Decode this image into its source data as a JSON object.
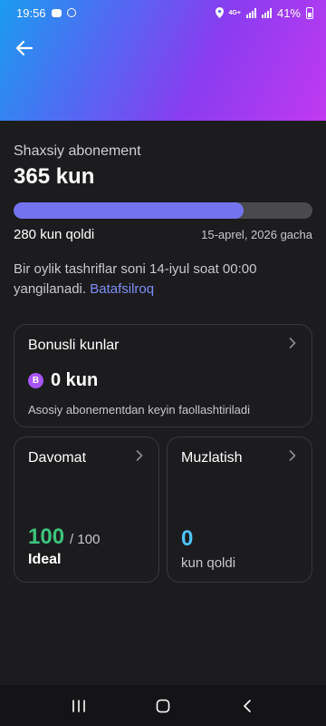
{
  "status_bar": {
    "time": "19:56",
    "network": "4G+",
    "battery": "41%"
  },
  "subscription": {
    "title": "Shaxsiy abonement",
    "total": "365 kun",
    "progress_fraction": 0.77,
    "remaining": "280 kun qoldi",
    "until": "15-aprel, 2026 gacha",
    "info_text": "Bir oylik tashriflar soni 14-iyul soat 00:00 yangilanadi.",
    "info_link": "Batafsilroq"
  },
  "bonus": {
    "title": "Bonusli kunlar",
    "badge": "B",
    "value": "0 kun",
    "description": "Asosiy abonementdan keyin faollashtiriladi"
  },
  "attendance": {
    "title": "Davomat",
    "value": "100",
    "max": "/ 100",
    "label": "Ideal"
  },
  "freeze": {
    "title": "Muzlatish",
    "value": "0",
    "label": "kun qoldi"
  },
  "colors": {
    "progress_fill": "#7474ef",
    "attendance_value": "#3cc47c",
    "freeze_value": "#4fc3f7",
    "badge": "#a855f7",
    "link": "#7e8df5"
  },
  "icons": {
    "back": "arrow-left-icon",
    "chevron": "chevron-right-icon",
    "nav_recents": "recents-icon",
    "nav_home": "home-icon",
    "nav_back": "nav-back-icon"
  }
}
